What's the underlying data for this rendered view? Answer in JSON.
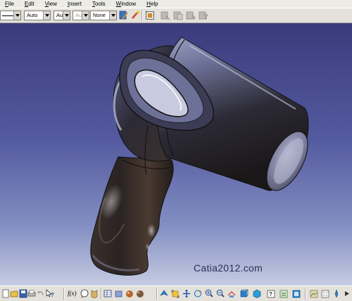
{
  "menubar": {
    "items": [
      "File",
      "Edit",
      "View",
      "Insert",
      "Tools",
      "Window",
      "Help"
    ]
  },
  "toolbar": {
    "color_value": "Auto",
    "linetype_value": "Aut",
    "thickness_value": "Aut",
    "layer_value": "None"
  },
  "viewport": {
    "watermark": "Catia2012.com"
  },
  "bottom_toolbar": {
    "fog_label": "f(x)"
  }
}
